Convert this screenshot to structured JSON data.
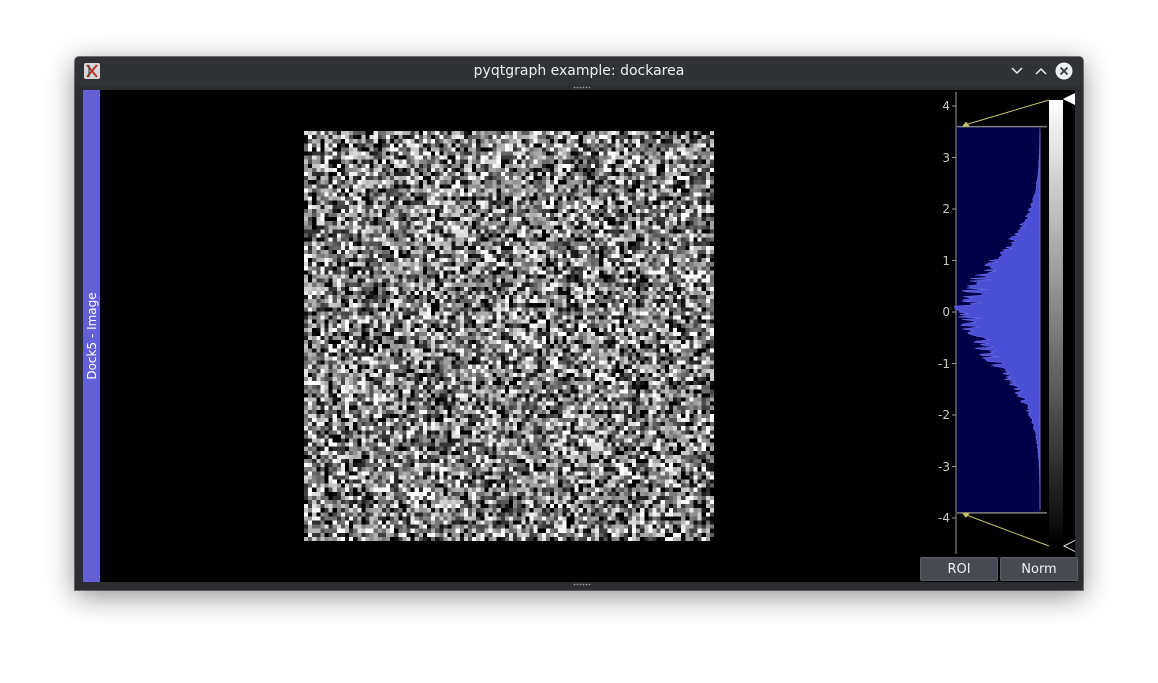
{
  "window": {
    "title": "pyqtgraph example: dockarea",
    "controls": [
      "minimize",
      "maximize",
      "close"
    ]
  },
  "dock": {
    "label": "Dock5 - Image",
    "accent_color": "#6460d6"
  },
  "image": {
    "description_colormap": "grayscale",
    "pixels": "100x100 random noise"
  },
  "histogram": {
    "axis_ticks": [
      "4",
      "3",
      "2",
      "1",
      "0",
      "-1",
      "-2",
      "-3",
      "-4"
    ],
    "region_color": "#000048",
    "histogram_color": "#4b4fd6",
    "level_max": 3.6,
    "level_min": -3.9
  },
  "buttons": {
    "roi_label": "ROI",
    "norm_label": "Norm"
  }
}
